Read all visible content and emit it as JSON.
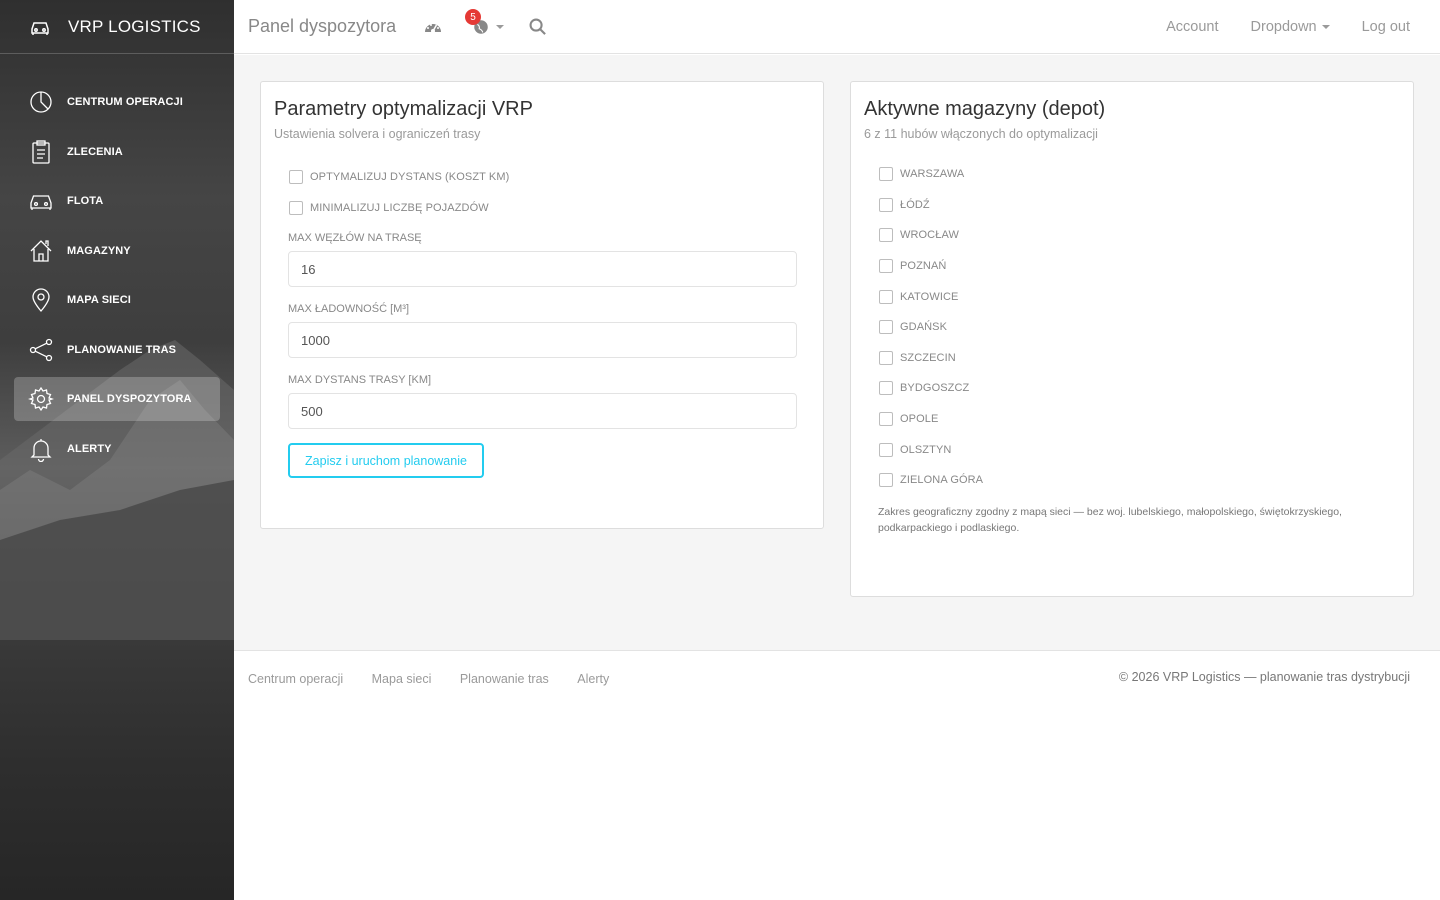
{
  "sidebar": {
    "logo_text": "VRP LOGISTICS",
    "logo_icon": "car-icon",
    "items": [
      {
        "label": "CENTRUM OPERACJI",
        "icon": "pie-chart-icon",
        "active": false
      },
      {
        "label": "ZLECENIA",
        "icon": "clipboard-icon",
        "active": false
      },
      {
        "label": "FLOTA",
        "icon": "car-icon",
        "active": false
      },
      {
        "label": "MAGAZYNY",
        "icon": "home-icon",
        "active": false
      },
      {
        "label": "MAPA SIECI",
        "icon": "map-pin-icon",
        "active": false
      },
      {
        "label": "PLANOWANIE TRAS",
        "icon": "share-icon",
        "active": false
      },
      {
        "label": "PANEL DYSPOZYTORA",
        "icon": "gear-icon",
        "active": true
      },
      {
        "label": "ALERTY",
        "icon": "bell-icon",
        "active": false
      }
    ]
  },
  "topbar": {
    "brand": "Panel dyspozytora",
    "notification_count": "5",
    "account": "Account",
    "dropdown": "Dropdown",
    "logout": "Log out"
  },
  "card_params": {
    "title": "Parametry optymalizacji VRP",
    "subtitle": "Ustawienia solvera i ograniczeń trasy",
    "checkboxes": [
      {
        "label": "Optymalizuj dystans (koszt km)",
        "checked": false
      },
      {
        "label": "Minimalizuj liczbę pojazdów",
        "checked": false
      }
    ],
    "fields": [
      {
        "label": "Max węzłów na trasę",
        "value": "16"
      },
      {
        "label": "Max ładowność [m³]",
        "value": "1000"
      },
      {
        "label": "Max dystans trasy [km]",
        "value": "500"
      }
    ],
    "save_button": "Zapisz i uruchom planowanie"
  },
  "card_depots": {
    "title": "Aktywne magazyny (depot)",
    "subtitle": "6 z 11 hubów włączonych do optymalizacji",
    "depots": [
      {
        "label": "Warszawa",
        "checked": false
      },
      {
        "label": "Łódź",
        "checked": false
      },
      {
        "label": "Wrocław",
        "checked": false
      },
      {
        "label": "Poznań",
        "checked": false
      },
      {
        "label": "Katowice",
        "checked": false
      },
      {
        "label": "Gdańsk",
        "checked": false
      },
      {
        "label": "Szczecin",
        "checked": false
      },
      {
        "label": "Bydgoszcz",
        "checked": false
      },
      {
        "label": "Opole",
        "checked": false
      },
      {
        "label": "Olsztyn",
        "checked": false
      },
      {
        "label": "Zielona Góra",
        "checked": false
      }
    ],
    "note": "Zakres geograficzny zgodny z mapą sieci — bez woj. lubelskiego, małopolskiego, świętokrzyskiego, podkarpackiego i podlaskiego."
  },
  "footer": {
    "links": [
      "Centrum operacji",
      "Mapa sieci",
      "Planowanie tras",
      "Alerty"
    ],
    "copyright": "© 2026 VRP Logistics — planowanie tras dystrybucji"
  },
  "colors": {
    "accent": "#23ccef",
    "badge": "#e53935",
    "sidebar_dark": "#2f2f2f",
    "content_bg": "#f5f5f5"
  }
}
